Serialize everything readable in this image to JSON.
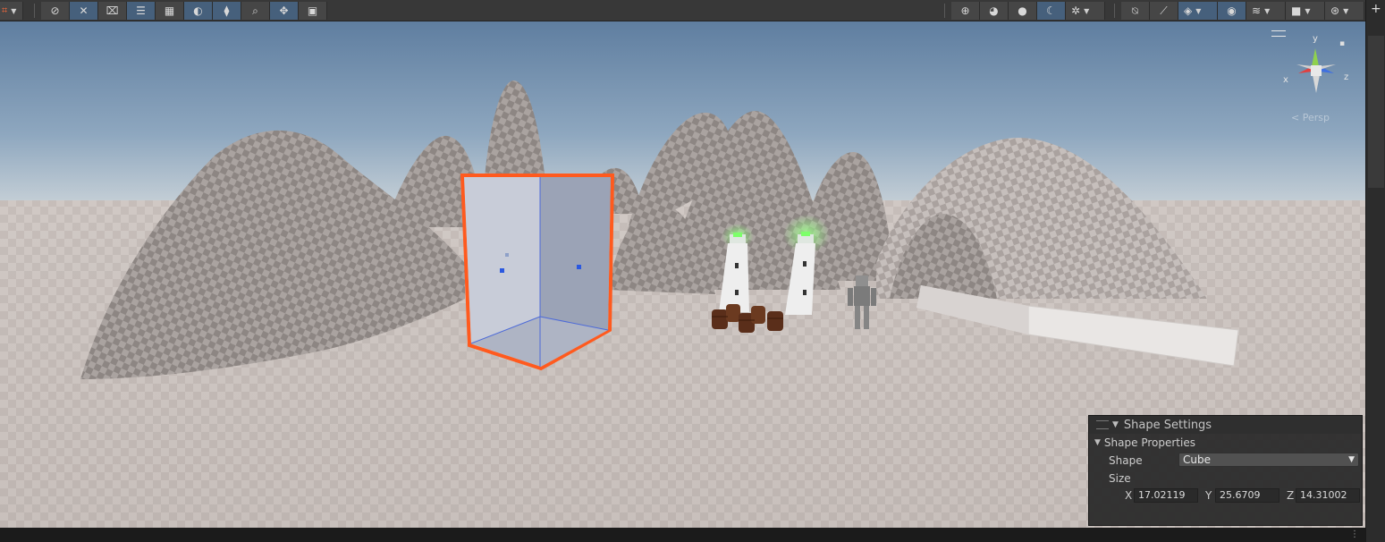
{
  "scene_view": {
    "gizmo": {
      "x_label": "x",
      "y_label": "y",
      "z_label": "z"
    },
    "projection_label": "Persp"
  },
  "overlay": {
    "title": "Shape Settings",
    "section": "Shape Properties",
    "shape_label": "Shape",
    "shape_value": "Cube",
    "size_label": "Size",
    "size": {
      "x_label": "X",
      "x_value": "17.02119",
      "y_label": "Y",
      "y_value": "25.6709",
      "z_label": "Z",
      "z_value": "14.31002"
    }
  },
  "toolbar": {
    "left_tools": [
      "tool-handle-icon",
      "tool-x-icon",
      "tool-scale-icon",
      "tool-align-icon",
      "tool-grid-icon",
      "tool-circle-icon",
      "tool-layers-icon",
      "search-icon",
      "tool-move-icon",
      "tool-camera-icon"
    ],
    "active_tools": [
      2,
      3,
      5,
      6
    ]
  },
  "colors": {
    "selection_outline": "#ff5a1e",
    "active_button": "#46607c",
    "sky_top": "#5f7ea0",
    "ground": "#c8c0bc"
  }
}
